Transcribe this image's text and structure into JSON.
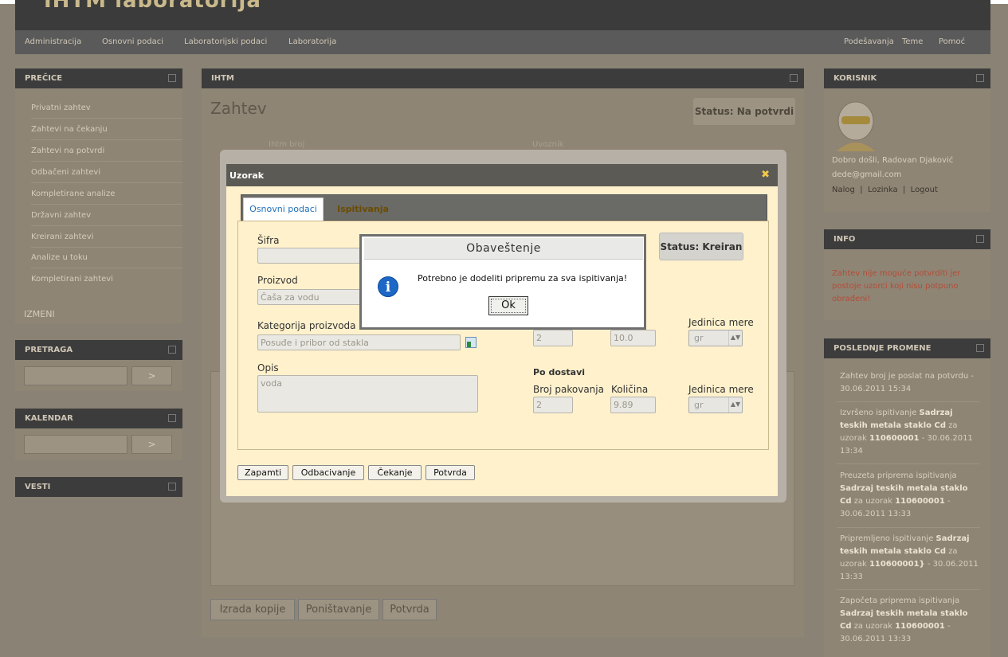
{
  "app": {
    "title": "IHTM laboratorija"
  },
  "top_nav": {
    "left": [
      "Administracija",
      "Osnovni podaci",
      "Laboratorijski podaci",
      "Laboratorija"
    ],
    "right": [
      "Podešavanja",
      "Teme",
      "Pomoć"
    ]
  },
  "sidebar": {
    "precice": {
      "title": "PREČICE",
      "items": [
        "Privatni zahtev",
        "Zahtevi na čekanju",
        "Zahtevi na potvrdi",
        "Odbačeni zahtevi",
        "Kompletirane analize",
        "Državni zahtev",
        "Kreirani zahtevi",
        "Analize u toku",
        "Kompletirani zahtevi"
      ],
      "izmeni": "IZMENI"
    },
    "pretraga": {
      "title": "PRETRAGA",
      "button": ">"
    },
    "kalendar": {
      "title": "KALENDAR",
      "button": ">"
    },
    "vesti": {
      "title": "VESTI"
    }
  },
  "main": {
    "panel_title": "IHTM",
    "heading": "Zahtev",
    "status": "Status: Na potvrdi",
    "ihtm_broj_label": "Ihtm broj",
    "uvoznik_label": "Uvoznik",
    "buttons": [
      "Izrada kopije",
      "Poništavanje",
      "Potvrda"
    ]
  },
  "right": {
    "korisnik": {
      "title": "KORISNIK",
      "welcome": "Dobro došli,",
      "name": "Radovan Djaković",
      "email": "dede@gmail.com",
      "links": [
        "Nalog",
        "Lozinka",
        "Logout"
      ],
      "sep": "|"
    },
    "info": {
      "title": "INFO",
      "text": "Zahtev nije moguće potvrditi jer postoje uzorci koji nisu potpuno obrađeni!"
    },
    "poslednje": {
      "title": "POSLEDNJE PROMENE",
      "items": [
        {
          "pre": "Zahtev broj je poslat na potvrdu",
          "b1": "",
          "mid": "",
          "b2": "",
          "post": "- 30.06.2011 15:34"
        },
        {
          "pre": "Izvršeno ispitivanje",
          "b1": "Sadrzaj teskih metala staklo Cd",
          "mid": "za uzorak",
          "b2": "110600001",
          "post": "- 30.06.2011 13:34"
        },
        {
          "pre": "Preuzeta priprema ispitivanja",
          "b1": "Sadrzaj teskih metala staklo Cd",
          "mid": "za uzorak",
          "b2": "110600001",
          "post": "- 30.06.2011 13:33"
        },
        {
          "pre": "Pripremljeno ispitivanje",
          "b1": "Sadrzaj teskih metala staklo Cd",
          "mid": "za uzorak",
          "b2": "110600001}",
          "post": "- 30.06.2011 13:33"
        },
        {
          "pre": "Započeta priprema ispitivanja",
          "b1": "Sadrzaj teskih metala staklo Cd",
          "mid": "za uzorak",
          "b2": "110600001",
          "post": "- 30.06.2011 13:33"
        }
      ]
    }
  },
  "modal": {
    "title": "Uzorak",
    "close": "✖",
    "tabs": [
      "Osnovni podaci",
      "Ispitivanja"
    ],
    "status": "Status: Kreiran",
    "sifra_label": "Šifra",
    "sifra_value": "",
    "proizvod_label": "Proizvod",
    "proizvod_value": "Čaša za vodu",
    "kategorija_label": "Kategorija proizvoda",
    "kategorija_value": "Posuđe i pribor od stakla",
    "opis_label": "Opis",
    "opis_value": "voda",
    "row1": {
      "jedinica_label": "Jedinica mere",
      "broj_value": "2",
      "kolicina_value": "10.0",
      "jedinica_value": "gr"
    },
    "po_dostavi": {
      "title": "Po dostavi",
      "broj_label": "Broj pakovanja",
      "kolicina_label": "Količina",
      "jedinica_label": "Jedinica mere",
      "broj_value": "2",
      "kolicina_value": "9.89",
      "jedinica_value": "gr"
    },
    "buttons": [
      "Zapamti",
      "Odbacivanje",
      "Čekanje",
      "Potvrda"
    ]
  },
  "alert": {
    "title": "Obaveštenje",
    "message": "Potrebno je dodeliti pripremu za sva ispitivanja!",
    "ok": "Ok",
    "icon": "i"
  }
}
